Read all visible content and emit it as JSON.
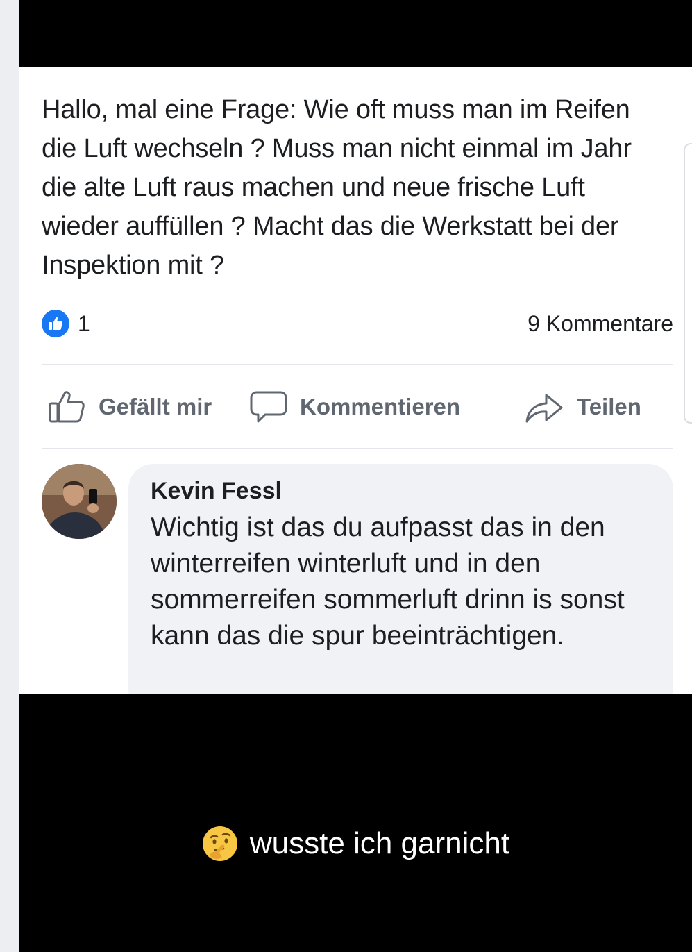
{
  "post": {
    "text": "Hallo, mal eine Frage: Wie oft muss man im Reifen die Luft wechseln ? Muss man nicht einmal im Jahr die alte Luft raus machen und neue frische Luft wieder auffüllen ? Macht das die Werkstatt bei der Inspektion mit ?",
    "like_count": "1",
    "comment_count": "9 Kommentare"
  },
  "actions": {
    "like_label": "Gefällt mir",
    "comment_label": "Kommentieren",
    "share_label": "Teilen"
  },
  "comment": {
    "author": "Kevin Fessl",
    "text": "Wichtig ist das du aufpasst das in den winterreifen winterluft und in den sommerreifen sommerluft drinn is sonst kann das die spur beeinträchtigen."
  },
  "caption": {
    "emoji": "thinking-face-icon",
    "text": "wusste ich garnicht"
  },
  "colors": {
    "brand": "#1877f2",
    "text": "#1c1e21",
    "muted": "#606770",
    "bubble": "#f0f2f5"
  }
}
